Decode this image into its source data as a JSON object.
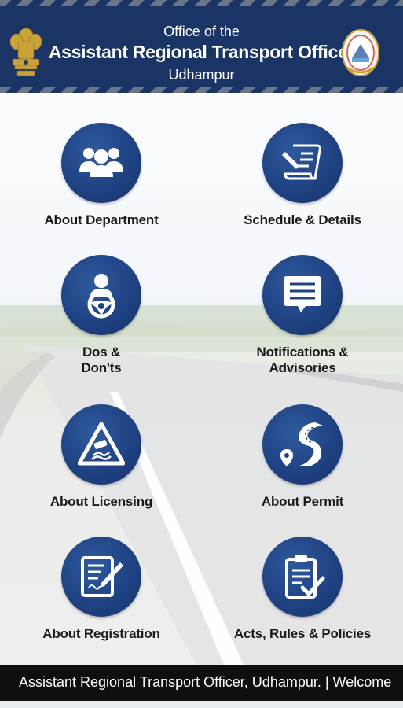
{
  "header": {
    "line1": "Office of the",
    "line2": "Assistant Regional Transport Officer",
    "line3": "Udhampur"
  },
  "menu": [
    {
      "label": "About Department",
      "icon": "people-group-icon"
    },
    {
      "label": "Schedule & Details",
      "icon": "document-pen-icon"
    },
    {
      "label_line1": "Dos &",
      "label_line2": "Don'ts",
      "icon": "driver-steering-icon"
    },
    {
      "label_line1": "Notifications &",
      "label_line2": "Advisories",
      "icon": "message-bubble-icon"
    },
    {
      "label": "About Licensing",
      "icon": "slippery-road-sign-icon"
    },
    {
      "label": "About Permit",
      "icon": "road-location-icon"
    },
    {
      "label": "About Registration",
      "icon": "form-pen-icon"
    },
    {
      "label": "Acts, Rules & Policies",
      "icon": "clipboard-check-icon"
    }
  ],
  "footer": {
    "ticker": "Assistant Regional Transport Officer, Udhampur.   |   Welcome"
  },
  "colors": {
    "header_bg": "#1b3466",
    "circle": "#1f4283",
    "footer_bg": "#0f0f0f"
  }
}
